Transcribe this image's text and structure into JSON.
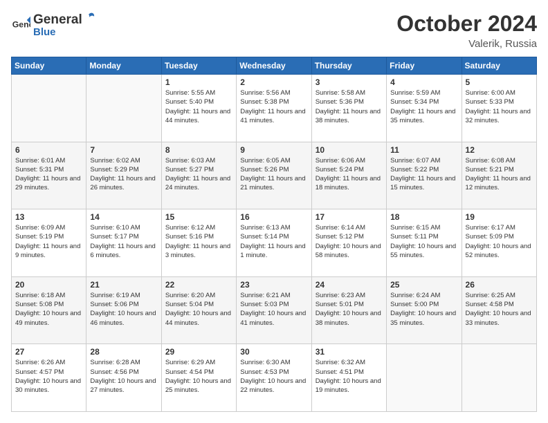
{
  "header": {
    "logo_general": "General",
    "logo_blue": "Blue",
    "month_title": "October 2024",
    "location": "Valerik, Russia"
  },
  "weekdays": [
    "Sunday",
    "Monday",
    "Tuesday",
    "Wednesday",
    "Thursday",
    "Friday",
    "Saturday"
  ],
  "weeks": [
    [
      {
        "day": "",
        "sunrise": "",
        "sunset": "",
        "daylight": ""
      },
      {
        "day": "",
        "sunrise": "",
        "sunset": "",
        "daylight": ""
      },
      {
        "day": "1",
        "sunrise": "Sunrise: 5:55 AM",
        "sunset": "Sunset: 5:40 PM",
        "daylight": "Daylight: 11 hours and 44 minutes."
      },
      {
        "day": "2",
        "sunrise": "Sunrise: 5:56 AM",
        "sunset": "Sunset: 5:38 PM",
        "daylight": "Daylight: 11 hours and 41 minutes."
      },
      {
        "day": "3",
        "sunrise": "Sunrise: 5:58 AM",
        "sunset": "Sunset: 5:36 PM",
        "daylight": "Daylight: 11 hours and 38 minutes."
      },
      {
        "day": "4",
        "sunrise": "Sunrise: 5:59 AM",
        "sunset": "Sunset: 5:34 PM",
        "daylight": "Daylight: 11 hours and 35 minutes."
      },
      {
        "day": "5",
        "sunrise": "Sunrise: 6:00 AM",
        "sunset": "Sunset: 5:33 PM",
        "daylight": "Daylight: 11 hours and 32 minutes."
      }
    ],
    [
      {
        "day": "6",
        "sunrise": "Sunrise: 6:01 AM",
        "sunset": "Sunset: 5:31 PM",
        "daylight": "Daylight: 11 hours and 29 minutes."
      },
      {
        "day": "7",
        "sunrise": "Sunrise: 6:02 AM",
        "sunset": "Sunset: 5:29 PM",
        "daylight": "Daylight: 11 hours and 26 minutes."
      },
      {
        "day": "8",
        "sunrise": "Sunrise: 6:03 AM",
        "sunset": "Sunset: 5:27 PM",
        "daylight": "Daylight: 11 hours and 24 minutes."
      },
      {
        "day": "9",
        "sunrise": "Sunrise: 6:05 AM",
        "sunset": "Sunset: 5:26 PM",
        "daylight": "Daylight: 11 hours and 21 minutes."
      },
      {
        "day": "10",
        "sunrise": "Sunrise: 6:06 AM",
        "sunset": "Sunset: 5:24 PM",
        "daylight": "Daylight: 11 hours and 18 minutes."
      },
      {
        "day": "11",
        "sunrise": "Sunrise: 6:07 AM",
        "sunset": "Sunset: 5:22 PM",
        "daylight": "Daylight: 11 hours and 15 minutes."
      },
      {
        "day": "12",
        "sunrise": "Sunrise: 6:08 AM",
        "sunset": "Sunset: 5:21 PM",
        "daylight": "Daylight: 11 hours and 12 minutes."
      }
    ],
    [
      {
        "day": "13",
        "sunrise": "Sunrise: 6:09 AM",
        "sunset": "Sunset: 5:19 PM",
        "daylight": "Daylight: 11 hours and 9 minutes."
      },
      {
        "day": "14",
        "sunrise": "Sunrise: 6:10 AM",
        "sunset": "Sunset: 5:17 PM",
        "daylight": "Daylight: 11 hours and 6 minutes."
      },
      {
        "day": "15",
        "sunrise": "Sunrise: 6:12 AM",
        "sunset": "Sunset: 5:16 PM",
        "daylight": "Daylight: 11 hours and 3 minutes."
      },
      {
        "day": "16",
        "sunrise": "Sunrise: 6:13 AM",
        "sunset": "Sunset: 5:14 PM",
        "daylight": "Daylight: 11 hours and 1 minute."
      },
      {
        "day": "17",
        "sunrise": "Sunrise: 6:14 AM",
        "sunset": "Sunset: 5:12 PM",
        "daylight": "Daylight: 10 hours and 58 minutes."
      },
      {
        "day": "18",
        "sunrise": "Sunrise: 6:15 AM",
        "sunset": "Sunset: 5:11 PM",
        "daylight": "Daylight: 10 hours and 55 minutes."
      },
      {
        "day": "19",
        "sunrise": "Sunrise: 6:17 AM",
        "sunset": "Sunset: 5:09 PM",
        "daylight": "Daylight: 10 hours and 52 minutes."
      }
    ],
    [
      {
        "day": "20",
        "sunrise": "Sunrise: 6:18 AM",
        "sunset": "Sunset: 5:08 PM",
        "daylight": "Daylight: 10 hours and 49 minutes."
      },
      {
        "day": "21",
        "sunrise": "Sunrise: 6:19 AM",
        "sunset": "Sunset: 5:06 PM",
        "daylight": "Daylight: 10 hours and 46 minutes."
      },
      {
        "day": "22",
        "sunrise": "Sunrise: 6:20 AM",
        "sunset": "Sunset: 5:04 PM",
        "daylight": "Daylight: 10 hours and 44 minutes."
      },
      {
        "day": "23",
        "sunrise": "Sunrise: 6:21 AM",
        "sunset": "Sunset: 5:03 PM",
        "daylight": "Daylight: 10 hours and 41 minutes."
      },
      {
        "day": "24",
        "sunrise": "Sunrise: 6:23 AM",
        "sunset": "Sunset: 5:01 PM",
        "daylight": "Daylight: 10 hours and 38 minutes."
      },
      {
        "day": "25",
        "sunrise": "Sunrise: 6:24 AM",
        "sunset": "Sunset: 5:00 PM",
        "daylight": "Daylight: 10 hours and 35 minutes."
      },
      {
        "day": "26",
        "sunrise": "Sunrise: 6:25 AM",
        "sunset": "Sunset: 4:58 PM",
        "daylight": "Daylight: 10 hours and 33 minutes."
      }
    ],
    [
      {
        "day": "27",
        "sunrise": "Sunrise: 6:26 AM",
        "sunset": "Sunset: 4:57 PM",
        "daylight": "Daylight: 10 hours and 30 minutes."
      },
      {
        "day": "28",
        "sunrise": "Sunrise: 6:28 AM",
        "sunset": "Sunset: 4:56 PM",
        "daylight": "Daylight: 10 hours and 27 minutes."
      },
      {
        "day": "29",
        "sunrise": "Sunrise: 6:29 AM",
        "sunset": "Sunset: 4:54 PM",
        "daylight": "Daylight: 10 hours and 25 minutes."
      },
      {
        "day": "30",
        "sunrise": "Sunrise: 6:30 AM",
        "sunset": "Sunset: 4:53 PM",
        "daylight": "Daylight: 10 hours and 22 minutes."
      },
      {
        "day": "31",
        "sunrise": "Sunrise: 6:32 AM",
        "sunset": "Sunset: 4:51 PM",
        "daylight": "Daylight: 10 hours and 19 minutes."
      },
      {
        "day": "",
        "sunrise": "",
        "sunset": "",
        "daylight": ""
      },
      {
        "day": "",
        "sunrise": "",
        "sunset": "",
        "daylight": ""
      }
    ]
  ]
}
